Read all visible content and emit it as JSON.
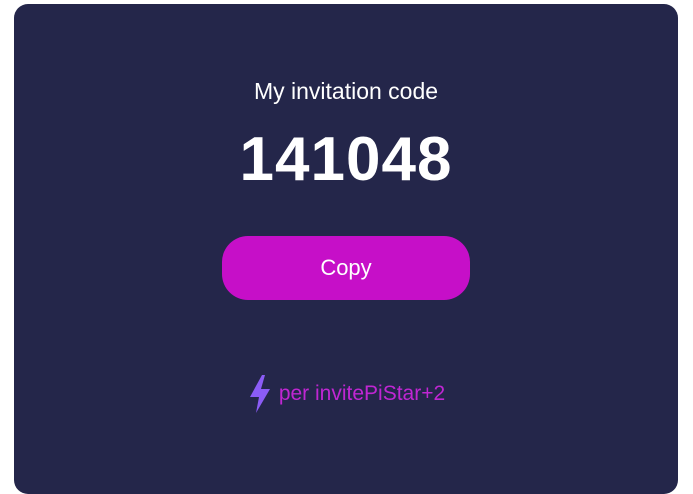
{
  "invite": {
    "title": "My invitation code",
    "code": "141048",
    "copy_label": "Copy",
    "reward_text": "per invitePiStar+2",
    "reward_icon": "lightning-bolt-icon"
  },
  "colors": {
    "card_background": "#24264a",
    "button": "#c60fc8",
    "reward_text": "#c026d3",
    "bolt": "#8b5cf6"
  }
}
